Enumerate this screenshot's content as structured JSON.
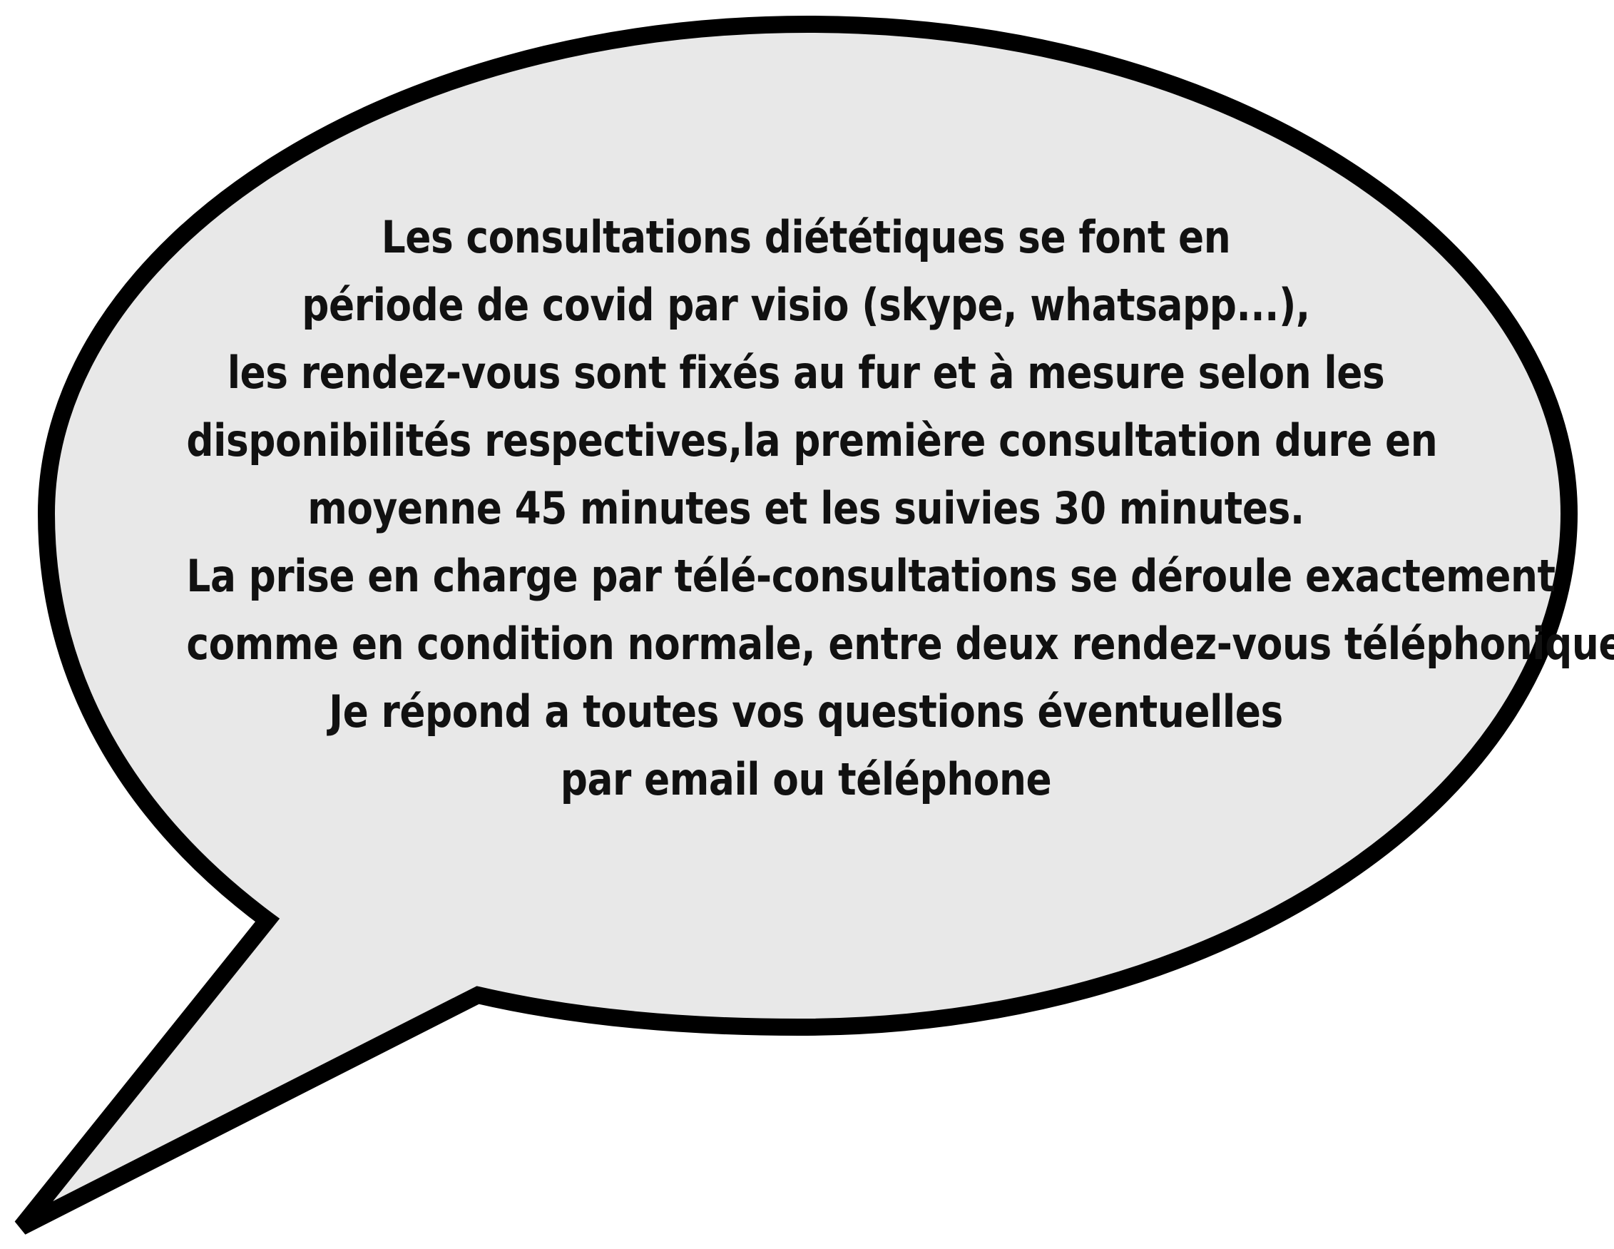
{
  "bubble": {
    "fill_color": "#e8e8e8",
    "stroke_color": "#000000",
    "lines": [
      "Les consultations diététiques se font en",
      "période de covid par visio (skype, whatsapp...),",
      "les rendez-vous sont fixés au fur et à mesure selon les",
      "disponibilités respectives,la première consultation dure en",
      "moyenne 45 minutes et les suivies 30 minutes.",
      "La prise en charge par télé-consultations se déroule exactement",
      "comme en condition normale, entre deux rendez-vous téléphonique.",
      "Je répond a toutes vos questions éventuelles",
      "par email ou téléphone"
    ]
  }
}
